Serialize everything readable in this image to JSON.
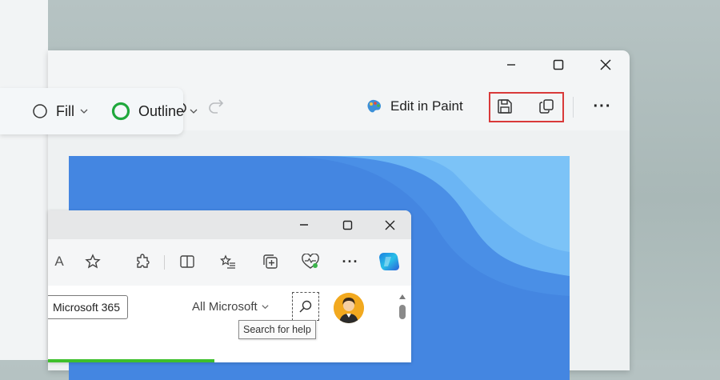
{
  "outer_window": {
    "caption": {
      "minimize_glyph": "—",
      "maximize_glyph": "☐",
      "close_glyph": "✕"
    },
    "toolbar": {
      "edit_in_paint_label": "Edit in Paint",
      "more_glyph": "···",
      "highlight_color": "#d93a3a"
    },
    "shape_popup": {
      "fill_label": "Fill",
      "outline_label": "Outline",
      "outline_color": "#1fa83c"
    }
  },
  "inner_window": {
    "caption": {
      "minimize_glyph": "—",
      "maximize_glyph": "☐",
      "close_glyph": "✕"
    },
    "nav": {
      "read_aloud_glyph": "A",
      "more_glyph": "···"
    },
    "content": {
      "m365_button_label": "Microsoft 365",
      "all_microsoft_label": "All Microsoft",
      "tooltip_text": "Search for help"
    }
  },
  "colors": {
    "wallpaper": "#5aa8f0",
    "accent_green": "#3fc02c"
  }
}
